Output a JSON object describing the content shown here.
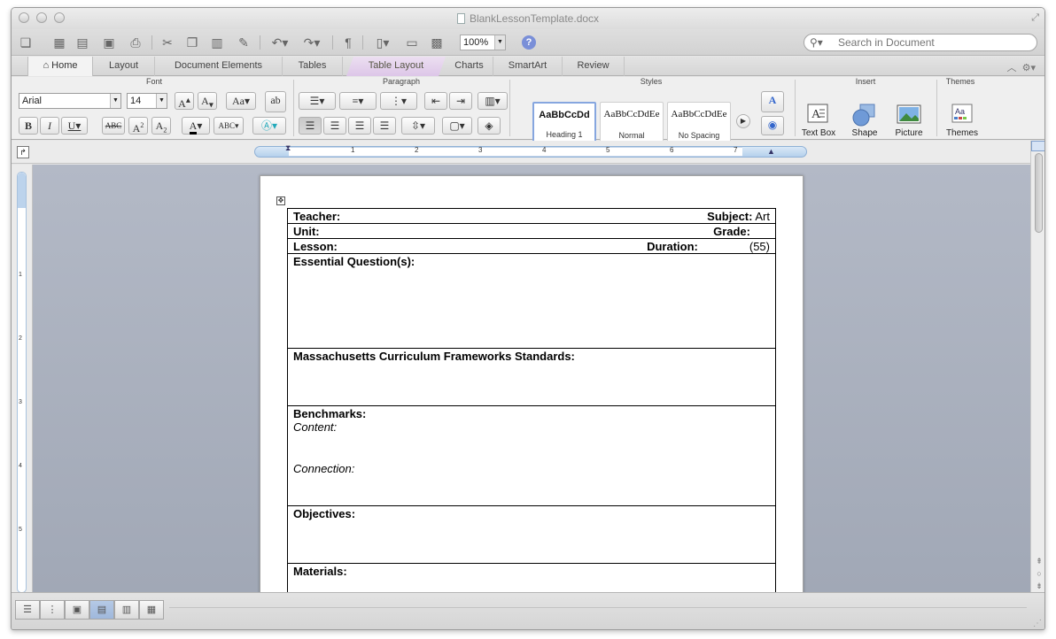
{
  "window": {
    "title": "BlankLessonTemplate.docx"
  },
  "toolbar": {
    "zoom": "100%",
    "search_placeholder": "Search in Document"
  },
  "tabs": [
    {
      "label": "Home"
    },
    {
      "label": "Layout"
    },
    {
      "label": "Document Elements"
    },
    {
      "label": "Tables"
    },
    {
      "label": "Table Layout"
    },
    {
      "label": "Charts"
    },
    {
      "label": "SmartArt"
    },
    {
      "label": "Review"
    }
  ],
  "ribbon": {
    "groups": {
      "font": "Font",
      "paragraph": "Paragraph",
      "styles": "Styles",
      "insert": "Insert",
      "themes": "Themes"
    },
    "font_name": "Arial",
    "font_size": "14",
    "styles": [
      {
        "sample": "AaBbCcDd",
        "name": "Heading 1"
      },
      {
        "sample": "AaBbCcDdEe",
        "name": "Normal"
      },
      {
        "sample": "AaBbCcDdEe",
        "name": "No Spacing"
      }
    ],
    "insert_buttons": {
      "text_box": "Text Box",
      "shape": "Shape",
      "picture": "Picture"
    },
    "themes_button": "Themes"
  },
  "ruler": {
    "numbers": [
      "1",
      "2",
      "3",
      "4",
      "5",
      "6",
      "7"
    ]
  },
  "vruler": {
    "numbers": [
      "1",
      "2",
      "3",
      "4",
      "5"
    ]
  },
  "document": {
    "teacher_label": "Teacher:",
    "subject_label": "Subject:",
    "subject_value": "Art",
    "unit_label": "Unit:",
    "grade_label": "Grade:",
    "lesson_label": "Lesson:",
    "duration_label": "Duration:",
    "duration_value": "(55)",
    "essential_label": "Essential Question(s):",
    "standards_label": "Massachusetts Curriculum Frameworks Standards:",
    "benchmarks_label": "Benchmarks:",
    "content_label": "Content:",
    "connection_label": "Connection:",
    "objectives_label": "Objectives:",
    "materials_label": "Materials:"
  },
  "colors": {
    "accent": "#86a6df",
    "table_layout_tab": "#ddc6e8",
    "workspace": "#a8afbd"
  }
}
